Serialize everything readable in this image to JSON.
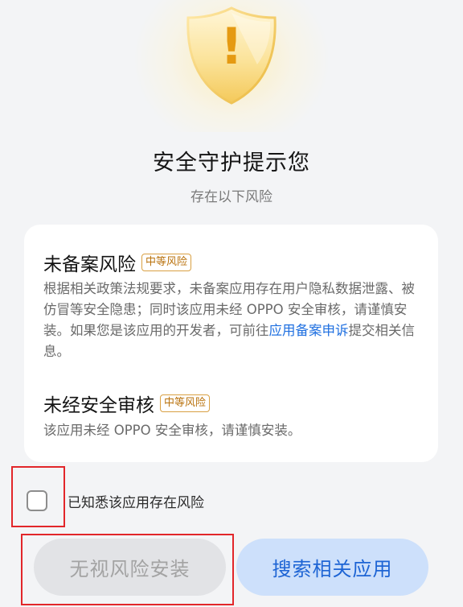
{
  "header": {
    "icon": "shield-warning-icon",
    "icon_symbol": "!",
    "title": "安全守护提示您",
    "subtitle": "存在以下风险"
  },
  "risks": [
    {
      "title": "未备案风险",
      "badge": "中等风险",
      "description_before_link": "根据相关政策法规要求，未备案应用存在用户隐私数据泄露、被仿冒等安全隐患；同时该应用未经 OPPO 安全审核，请谨慎安装。如果您是该应用的开发者，可前往",
      "link_text": "应用备案申诉",
      "description_after_link": "提交相关信息。"
    },
    {
      "title": "未经安全审核",
      "badge": "中等风险",
      "description": "该应用未经 OPPO 安全审核，请谨慎安装。"
    }
  ],
  "acknowledge": {
    "label": "已知悉该应用存在风险",
    "checked": false
  },
  "buttons": {
    "ignore_label": "无视风险安装",
    "search_label": "搜索相关应用"
  },
  "colors": {
    "accent_blue": "#1e6fe0",
    "badge_orange": "#b9720d",
    "highlight_red": "#e2262a",
    "shield_gold": "#f2bf3a"
  }
}
